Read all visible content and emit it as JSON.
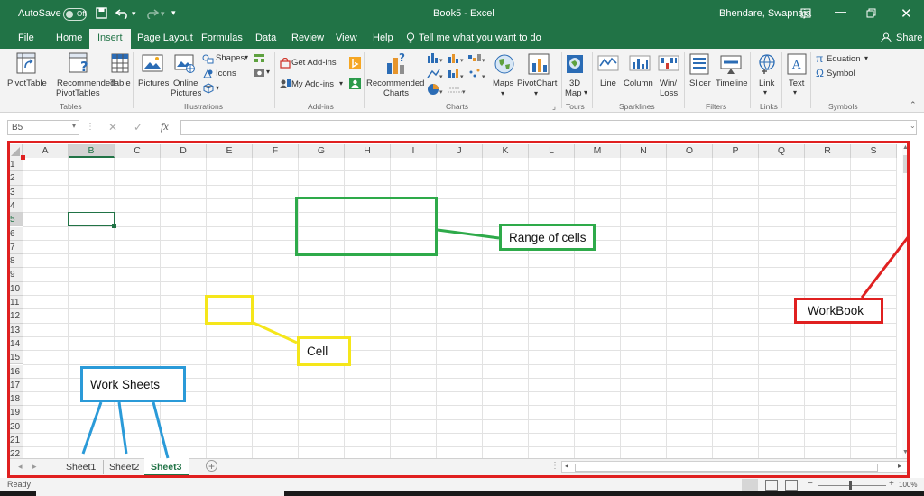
{
  "titlebar": {
    "autosave_label": "AutoSave",
    "autosave_state": "Off",
    "file_title": "Book5 - Excel",
    "user_name": "Bhendare, Swapnaja",
    "share_label": "Share"
  },
  "tabs": [
    "File",
    "Home",
    "Insert",
    "Page Layout",
    "Formulas",
    "Data",
    "Review",
    "View",
    "Help"
  ],
  "active_tab": "Insert",
  "tell_me": "Tell me what you want to do",
  "ribbon": {
    "pivottable": "PivotTable",
    "recommended_pivot_1": "Recommended",
    "recommended_pivot_2": "PivotTables",
    "table": "Table",
    "group_tables": "Tables",
    "pictures": "Pictures",
    "online_pictures_1": "Online",
    "online_pictures_2": "Pictures",
    "shapes": "Shapes",
    "icons": "Icons",
    "group_illustrations": "Illustrations",
    "get_addins": "Get Add-ins",
    "my_addins": "My Add-ins",
    "group_addins": "Add-ins",
    "recommended_charts_1": "Recommended",
    "recommended_charts_2": "Charts",
    "group_charts": "Charts",
    "maps": "Maps",
    "pivotchart": "PivotChart",
    "map3d_1": "3D",
    "map3d_2": "Map",
    "group_tours": "Tours",
    "line": "Line",
    "column": "Column",
    "winloss_1": "Win/",
    "winloss_2": "Loss",
    "group_sparklines": "Sparklines",
    "slicer": "Slicer",
    "timeline": "Timeline",
    "group_filters": "Filters",
    "link": "Link",
    "group_links": "Links",
    "text": "Text",
    "equation": "Equation",
    "symbol": "Symbol",
    "group_symbols": "Symbols"
  },
  "formula_bar": {
    "name_box": "B5",
    "fx": "fx",
    "value": ""
  },
  "columns": [
    "A",
    "B",
    "C",
    "D",
    "E",
    "F",
    "G",
    "H",
    "I",
    "J",
    "K",
    "L",
    "M",
    "N",
    "O",
    "P",
    "Q",
    "R",
    "S"
  ],
  "rows": [
    "1",
    "2",
    "3",
    "4",
    "5",
    "6",
    "7",
    "8",
    "9",
    "10",
    "11",
    "12",
    "13",
    "14",
    "15",
    "16",
    "17",
    "18",
    "19",
    "20",
    "21",
    "22"
  ],
  "selected_cell": "B5",
  "sheets": [
    "Sheet1",
    "Sheet2",
    "Sheet3"
  ],
  "active_sheet": "Sheet3",
  "status": {
    "ready": "Ready",
    "zoom": "100%"
  },
  "annotations": {
    "range_label": "Range of cells",
    "cell_label": "Cell",
    "workbook_label": "WorkBook",
    "worksheets_label": "Work Sheets"
  },
  "colors": {
    "excel_green": "#217346",
    "range_box": "#2eaa4a",
    "cell_box": "#f5e61a",
    "workbook_box": "#e02020",
    "worksheets_box": "#2a9ad8"
  }
}
